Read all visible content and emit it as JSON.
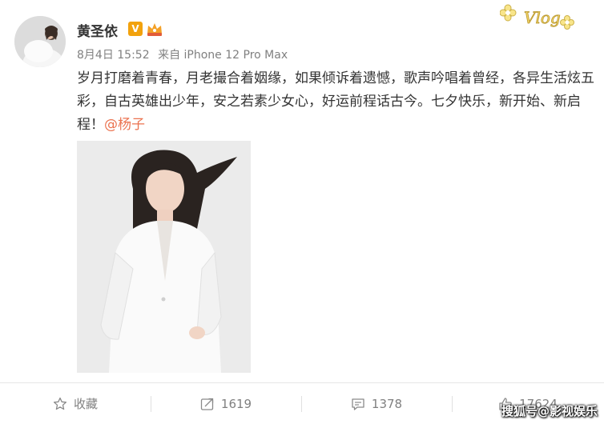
{
  "post": {
    "author": {
      "name": "黄圣依",
      "verified_mark": "V"
    },
    "meta": {
      "date": "8月4日 15:52",
      "source": "来自 iPhone 12 Pro Max"
    },
    "sticker_text": "Vlog",
    "content": {
      "text": "岁月打磨着青春，月老撮合着姻缘，如果倾诉着遗憾，歌声吟唱着曾经，各异生活炫五彩，自古英雄出少年，安之若素少女心，好运前程话古今。七夕快乐，新开始、新启程！",
      "mention": "@杨子"
    },
    "actions": {
      "favorite_label": "收藏",
      "repost_count": "1619",
      "comment_count": "1378",
      "like_count": "17624"
    }
  },
  "watermark": "搜狐号@影视娱乐",
  "colors": {
    "mention": "#eb7350",
    "badge": "#f2a20d",
    "meta": "#808080"
  }
}
